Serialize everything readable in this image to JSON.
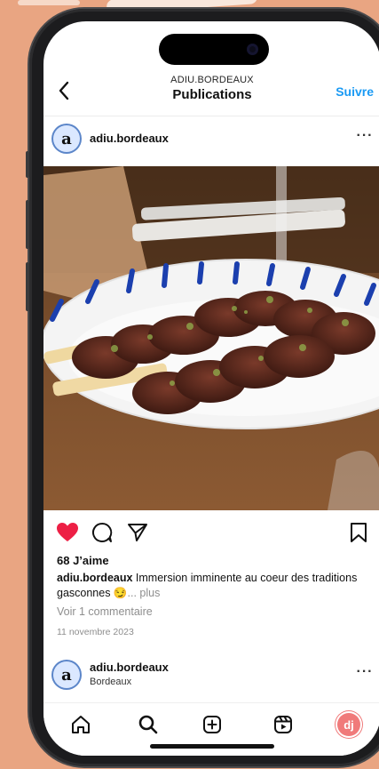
{
  "header": {
    "back_icon": "chevron-left-icon",
    "account_name": "ADIU.BORDEAUX",
    "title": "Publications",
    "follow_label": "Suivre"
  },
  "post": {
    "avatar_letter": "a",
    "username": "adiu.bordeaux",
    "more_icon": "more-horizontal-icon",
    "more_text": "···",
    "likes": "68 J’aime",
    "caption_user": "adiu.bordeaux",
    "caption_text": " Immersion imminente au coeur des traditions gasconnes 😏",
    "caption_more": "... plus",
    "comments_link": "Voir 1 commentaire",
    "date": "11 novembre 2023",
    "liked": true,
    "like_color": "#ed1f45"
  },
  "next_post": {
    "avatar_letter": "a",
    "username": "adiu.bordeaux",
    "location": "Bordeaux",
    "more_text": "···"
  },
  "tabbar": {
    "items": [
      "home-icon",
      "search-icon",
      "create-icon",
      "reels-icon",
      "profile-avatar"
    ],
    "profile_initials": "dj"
  },
  "colors": {
    "background": "#e9a582",
    "accent": "#1a9af4"
  }
}
